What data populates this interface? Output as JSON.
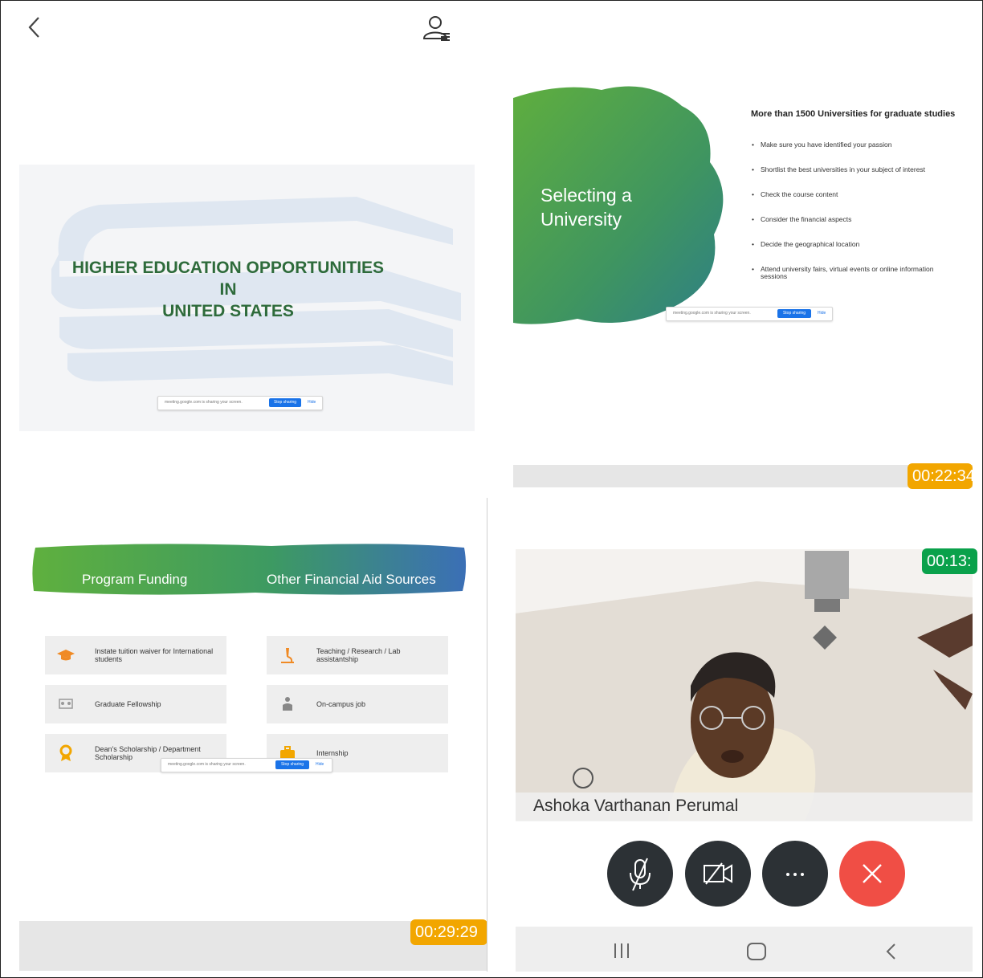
{
  "slide1": {
    "title_lines": [
      "HIGHER EDUCATION OPPORTUNITIES",
      "IN",
      "UNITED STATES"
    ]
  },
  "share_bar": {
    "text": "meeting.google.com is sharing your screen.",
    "stop_label": "Stop sharing",
    "hide_label": "Hide"
  },
  "slide2": {
    "title_lines": [
      "Selecting a",
      "University"
    ],
    "heading": "More than 1500 Universities for graduate studies",
    "bullets": [
      "Make sure you have identified your passion",
      "Shortlist the best universities in your subject of interest",
      "Check the course content",
      "Consider the financial aspects",
      "Decide the geographical location",
      "Attend university fairs, virtual events or online information sessions"
    ],
    "timer": "00:22:34"
  },
  "slide3": {
    "banner_left": "Program Funding",
    "banner_right": "Other Financial Aid Sources",
    "cards": [
      {
        "label": "Instate tuition waiver for International students",
        "icon": "graduation-cap-icon"
      },
      {
        "label": "Teaching / Research / Lab assistantship",
        "icon": "microscope-icon"
      },
      {
        "label": "Graduate Fellowship",
        "icon": "group-icon"
      },
      {
        "label": "On-campus job",
        "icon": "worker-icon"
      },
      {
        "label": "Dean's Scholarship / Department Scholarship",
        "icon": "award-ribbon-icon"
      },
      {
        "label": "Internship",
        "icon": "briefcase-icon"
      }
    ],
    "timer": "00:29:29"
  },
  "video": {
    "participant_name": "Ashoka Varthanan Perumal",
    "timer": "00:13:"
  },
  "colors": {
    "timer_orange": "#f2a600",
    "timer_green": "#0aa14b",
    "end_call_red": "#f04e45",
    "control_dark": "#2c3135"
  }
}
